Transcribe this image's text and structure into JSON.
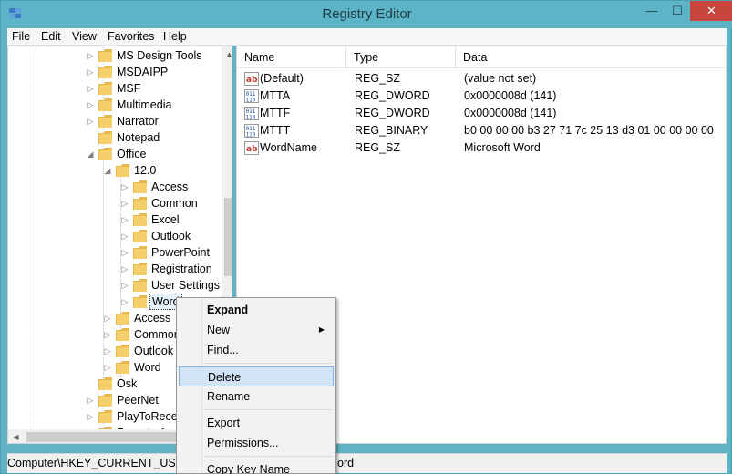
{
  "window": {
    "title": "Registry Editor",
    "min_glyph": "—",
    "max_glyph": "☐",
    "close_glyph": "✕"
  },
  "menubar": {
    "items": [
      "File",
      "Edit",
      "View",
      "Favorites",
      "Help"
    ]
  },
  "tree": {
    "nodes": [
      {
        "label": "MS Design Tools",
        "expander": "▷"
      },
      {
        "label": "MSDAIPP",
        "expander": "▷"
      },
      {
        "label": "MSF",
        "expander": "▷"
      },
      {
        "label": "Multimedia",
        "expander": "▷"
      },
      {
        "label": "Narrator",
        "expander": "▷"
      },
      {
        "label": "Notepad",
        "expander": ""
      },
      {
        "label": "Office",
        "expander": "◢"
      },
      {
        "label": "12.0",
        "expander": "◢"
      },
      {
        "label": "Access",
        "expander": "▷"
      },
      {
        "label": "Common",
        "expander": "▷"
      },
      {
        "label": "Excel",
        "expander": "▷"
      },
      {
        "label": "Outlook",
        "expander": "▷"
      },
      {
        "label": "PowerPoint",
        "expander": "▷"
      },
      {
        "label": "Registration",
        "expander": "▷"
      },
      {
        "label": "User Settings",
        "expander": "▷"
      },
      {
        "label": "Word",
        "expander": "▷"
      },
      {
        "label": "Access",
        "expander": "▷"
      },
      {
        "label": "Common",
        "expander": "▷"
      },
      {
        "label": "Outlook",
        "expander": "▷"
      },
      {
        "label": "Word",
        "expander": "▷"
      },
      {
        "label": "Osk",
        "expander": ""
      },
      {
        "label": "PeerNet",
        "expander": "▷"
      },
      {
        "label": "PlayToReceiver",
        "expander": "▷"
      },
      {
        "label": "Remote Assistance",
        "expander": "▷"
      }
    ]
  },
  "list": {
    "columns": [
      "Name",
      "Type",
      "Data"
    ],
    "rows": [
      {
        "name": "(Default)",
        "type": "REG_SZ",
        "data": "(value not set)",
        "icon": "string-value-icon"
      },
      {
        "name": "MTTA",
        "type": "REG_DWORD",
        "data": "0x0000008d (141)",
        "icon": "binary-value-icon"
      },
      {
        "name": "MTTF",
        "type": "REG_DWORD",
        "data": "0x0000008d (141)",
        "icon": "binary-value-icon"
      },
      {
        "name": "MTTT",
        "type": "REG_BINARY",
        "data": "b0 00 00 00 b3 27 71 7c 25 13 d3 01 00 00 00 00",
        "icon": "binary-value-icon"
      },
      {
        "name": "WordName",
        "type": "REG_SZ",
        "data": "Microsoft Word",
        "icon": "string-value-icon"
      }
    ]
  },
  "statusbar": {
    "path": "Computer\\HKEY_CURRENT_USER\\S",
    "path_tail": "ord"
  },
  "context_menu": {
    "expand": "Expand",
    "new": "New",
    "find": "Find...",
    "delete": "Delete",
    "rename": "Rename",
    "export": "Export",
    "permissions": "Permissions...",
    "copy_key_name": "Copy Key Name",
    "submenu_arrow": "▶"
  },
  "colors": {
    "titlebar": "#5db4c6",
    "highlight": "#d1e3f6",
    "folder": "#e8b84a"
  }
}
